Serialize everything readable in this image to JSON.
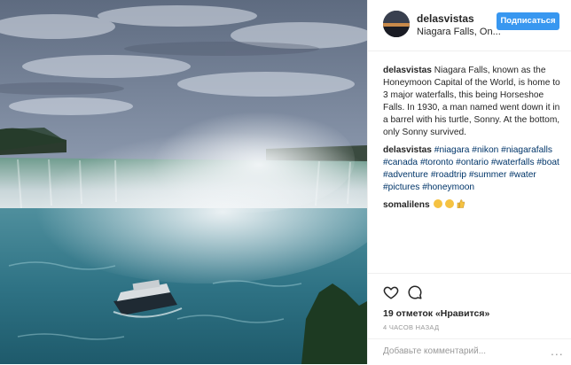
{
  "post": {
    "username": "delasvistas",
    "location": "Niagara Falls, On...",
    "follow_label": "Подписаться",
    "caption_user": "delasvistas",
    "caption_text": "Niagara Falls, known as the Honeymoon Capital of the World, is home to 3 major waterfalls, this being Horseshoe Falls. In 1930, a man named went down it in a barrel with his turtle, Sonny. At the bottom, only Sonny survived.",
    "hashtag_user": "delasvistas",
    "hashtags": [
      "#niagara",
      "#nikon",
      "#niagarafalls",
      "#canada",
      "#toronto",
      "#ontario",
      "#waterfalls",
      "#boat",
      "#adventure",
      "#roadtrip",
      "#summer",
      "#water",
      "#pictures",
      "#honeymoon"
    ],
    "reply_user": "somalilens",
    "reply_emoji": [
      "grinning-face-emoji",
      "grinning-face-emoji",
      "thumbs-up-emoji"
    ],
    "likes_text": "19 отметок «Нравится»",
    "time_text": "4 ЧАСОВ НАЗАД",
    "comment_placeholder": "Добавьте комментарий...",
    "more_label": "...",
    "icons": [
      "heart-icon",
      "comment-icon",
      "more-options-icon"
    ]
  },
  "colors": {
    "follow_button": "#3897f0",
    "hashtag": "#003569",
    "muted": "#999999",
    "text": "#262626"
  }
}
